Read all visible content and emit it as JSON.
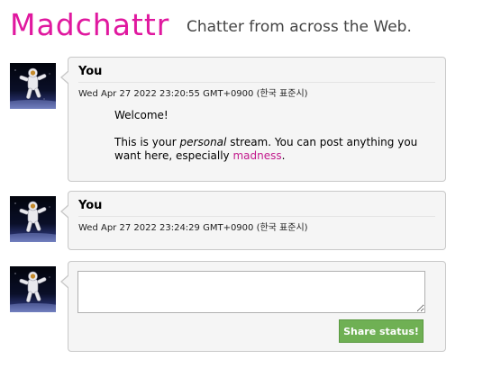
{
  "header": {
    "logo": "Madchattr",
    "tagline": "Chatter from across the Web."
  },
  "posts": [
    {
      "author": "You",
      "timestamp": "Wed Apr 27 2022 23:20:55 GMT+0900 (한국 표준시)",
      "body": {
        "greeting": "Welcome!",
        "line_before_em": "This is your ",
        "em": "personal",
        "line_after_em": " stream. You can post anything you want here, especially ",
        "link": "madness",
        "end": "."
      }
    },
    {
      "author": "You",
      "timestamp": "Wed Apr 27 2022 23:24:29 GMT+0900 (한국 표준시)"
    }
  ],
  "composer": {
    "placeholder": "",
    "button_label": "Share status!"
  },
  "icons": {
    "avatar": "astronaut-avatar-icon"
  },
  "colors": {
    "logo": "#e0189f",
    "link": "#c2188c",
    "button": "#6fb054"
  }
}
